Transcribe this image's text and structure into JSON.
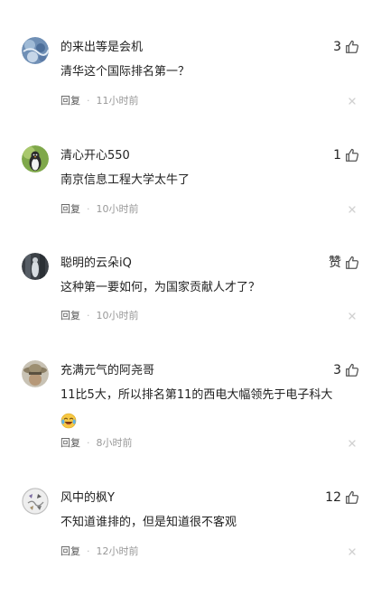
{
  "reply_label": "回复",
  "dot": "·",
  "colors": {
    "text_primary": "#222222",
    "text_secondary": "#999999",
    "reply_text": "#555555",
    "icon_gray": "#555555",
    "close_gray": "#d0d0d0",
    "background": "#ffffff"
  },
  "comments": [
    {
      "username": "的来出等是会机",
      "content": "清华这个国际排名第一？",
      "likes": "3",
      "time": "11小时前",
      "avatar": "blue-pattern-avatar"
    },
    {
      "username": "清心开心550",
      "content": "南京信息工程大学太牛了",
      "likes": "1",
      "time": "10小时前",
      "avatar": "penguin-avatar"
    },
    {
      "username": "聪明的云朵iQ",
      "content": "这种第一要如何，为国家贡献人才了？",
      "likes": "赞",
      "time": "10小时前",
      "avatar": "figure-avatar"
    },
    {
      "username": "充满元气的阿尧哥",
      "content": "11比5大，所以排名第11的西电大幅领先于电子科大",
      "emoji": "laughing-crying-emoji",
      "likes": "3",
      "time": "8小时前",
      "avatar": "hat-avatar"
    },
    {
      "username": "风中的枫Y",
      "content": "不知道谁排的，但是知道很不客观",
      "likes": "12",
      "time": "12小时前",
      "avatar": "sketch-avatar"
    }
  ]
}
